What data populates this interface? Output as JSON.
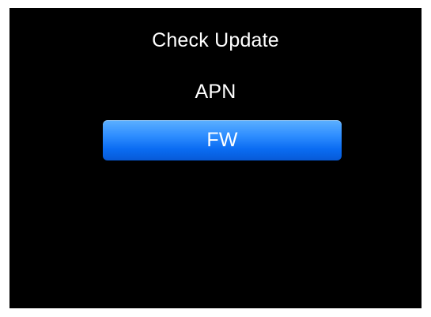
{
  "menu": {
    "items": [
      {
        "label": "Check Update",
        "selected": false
      },
      {
        "label": "APN",
        "selected": false
      },
      {
        "label": "FW",
        "selected": true
      }
    ]
  },
  "colors": {
    "background": "#000000",
    "text": "#ffffff",
    "selection": "#1a7cff"
  }
}
